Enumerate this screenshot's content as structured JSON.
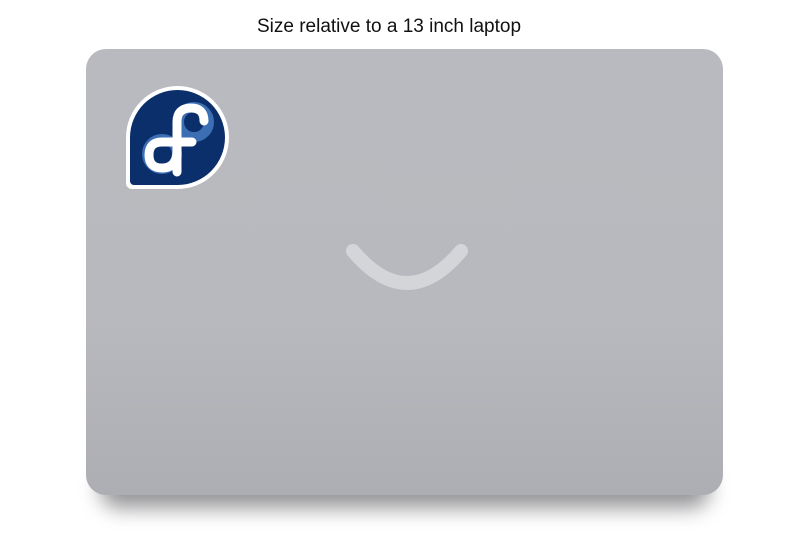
{
  "caption": "Size relative to a 13 inch laptop",
  "laptop": {
    "color": "#b9babf",
    "logo": "smile-icon"
  },
  "sticker": {
    "icon": "fedora-logo-icon",
    "colors": {
      "background": "#0b2f6b",
      "accent": "#3c6eb4",
      "border": "#ffffff"
    }
  }
}
